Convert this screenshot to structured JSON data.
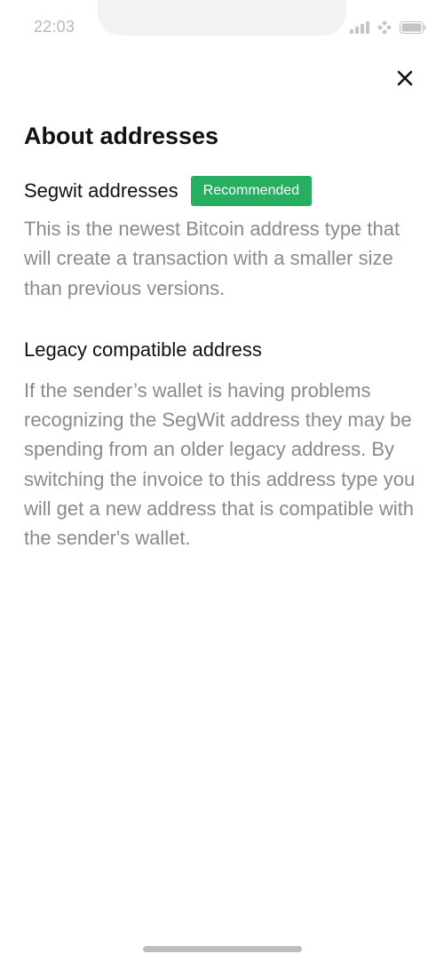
{
  "status_bar": {
    "time": "22:03",
    "icons": [
      "signal-icon",
      "wifi-icon",
      "battery-icon"
    ]
  },
  "header": {
    "close_icon": "close-icon"
  },
  "title": "About addresses",
  "segwit": {
    "title": "Segwit addresses",
    "badge": "Recommended",
    "description": "This is the newest Bitcoin address type that will create a transaction with a smaller size than previous versions."
  },
  "legacy": {
    "title": "Legacy compatible address",
    "description": "If the sender’s wallet is having problems recognizing the SegWit address they may be spending from an older legacy address. By switching the invoice to this address type you will get a new address that is compatible with the sender's wallet."
  },
  "colors": {
    "badge_background": "#27ae60",
    "body_text": "#8a8a8a",
    "title_text": "#111111"
  }
}
